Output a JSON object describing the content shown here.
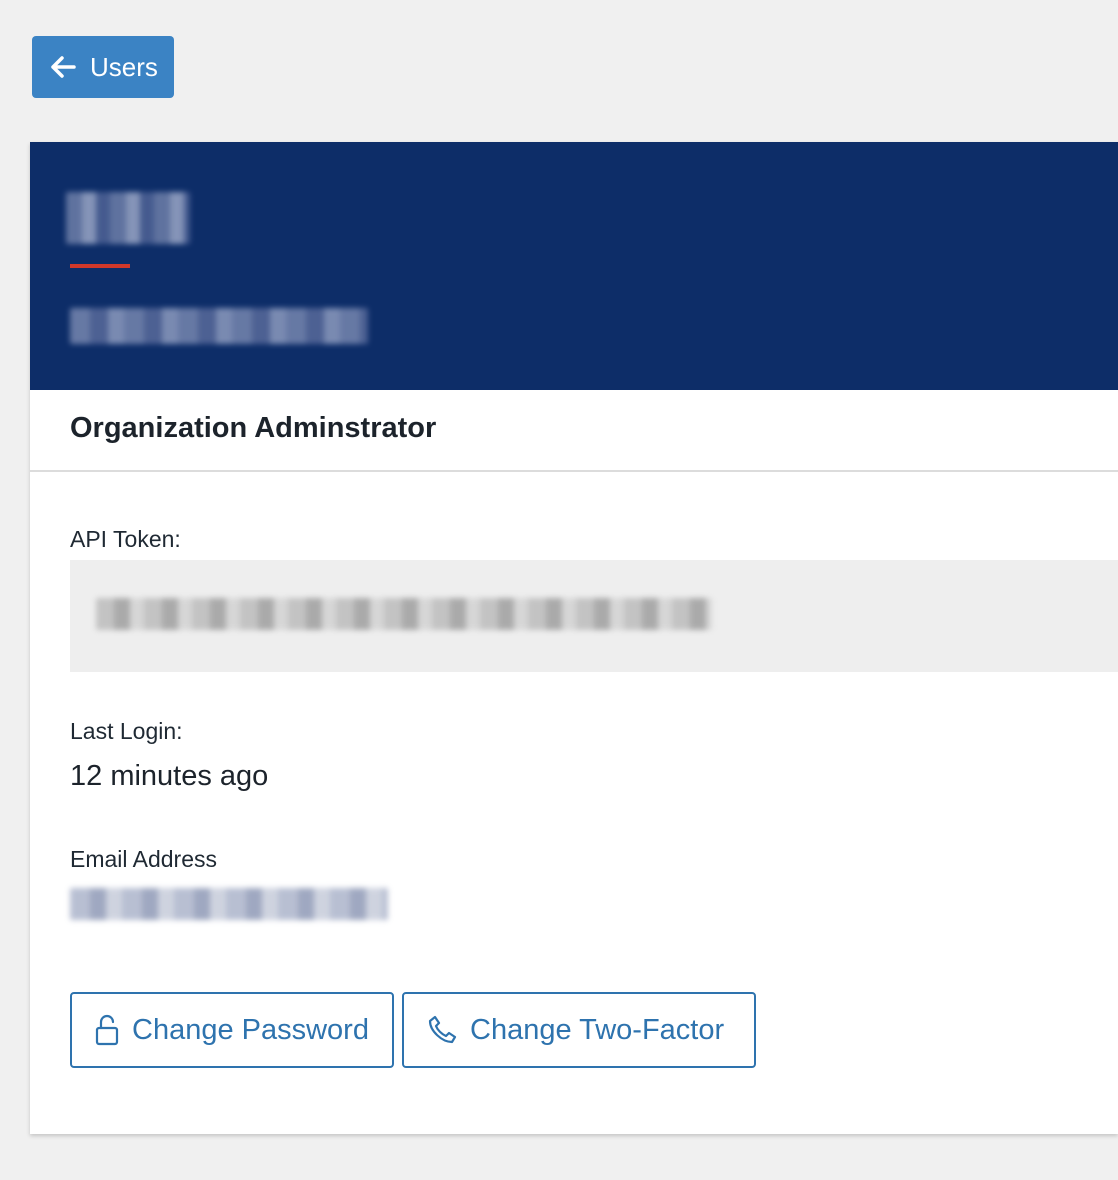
{
  "nav": {
    "back_label": "Users"
  },
  "profile": {
    "role": "Organization Adminstrator"
  },
  "fields": {
    "api_token_label": "API Token:",
    "last_login_label": "Last Login:",
    "last_login_value": "12 minutes ago",
    "email_label": "Email Address"
  },
  "actions": {
    "change_password_label": "Change Password",
    "change_two_factor_label": "Change Two-Factor"
  },
  "colors": {
    "primary_button": "#3b83c4",
    "header_background": "#0d2d68",
    "accent_line": "#d0382a",
    "outline_button": "#2e73ae"
  },
  "icons": {
    "back": "arrow-left-icon",
    "password": "unlock-icon",
    "two_factor": "phone-icon"
  }
}
